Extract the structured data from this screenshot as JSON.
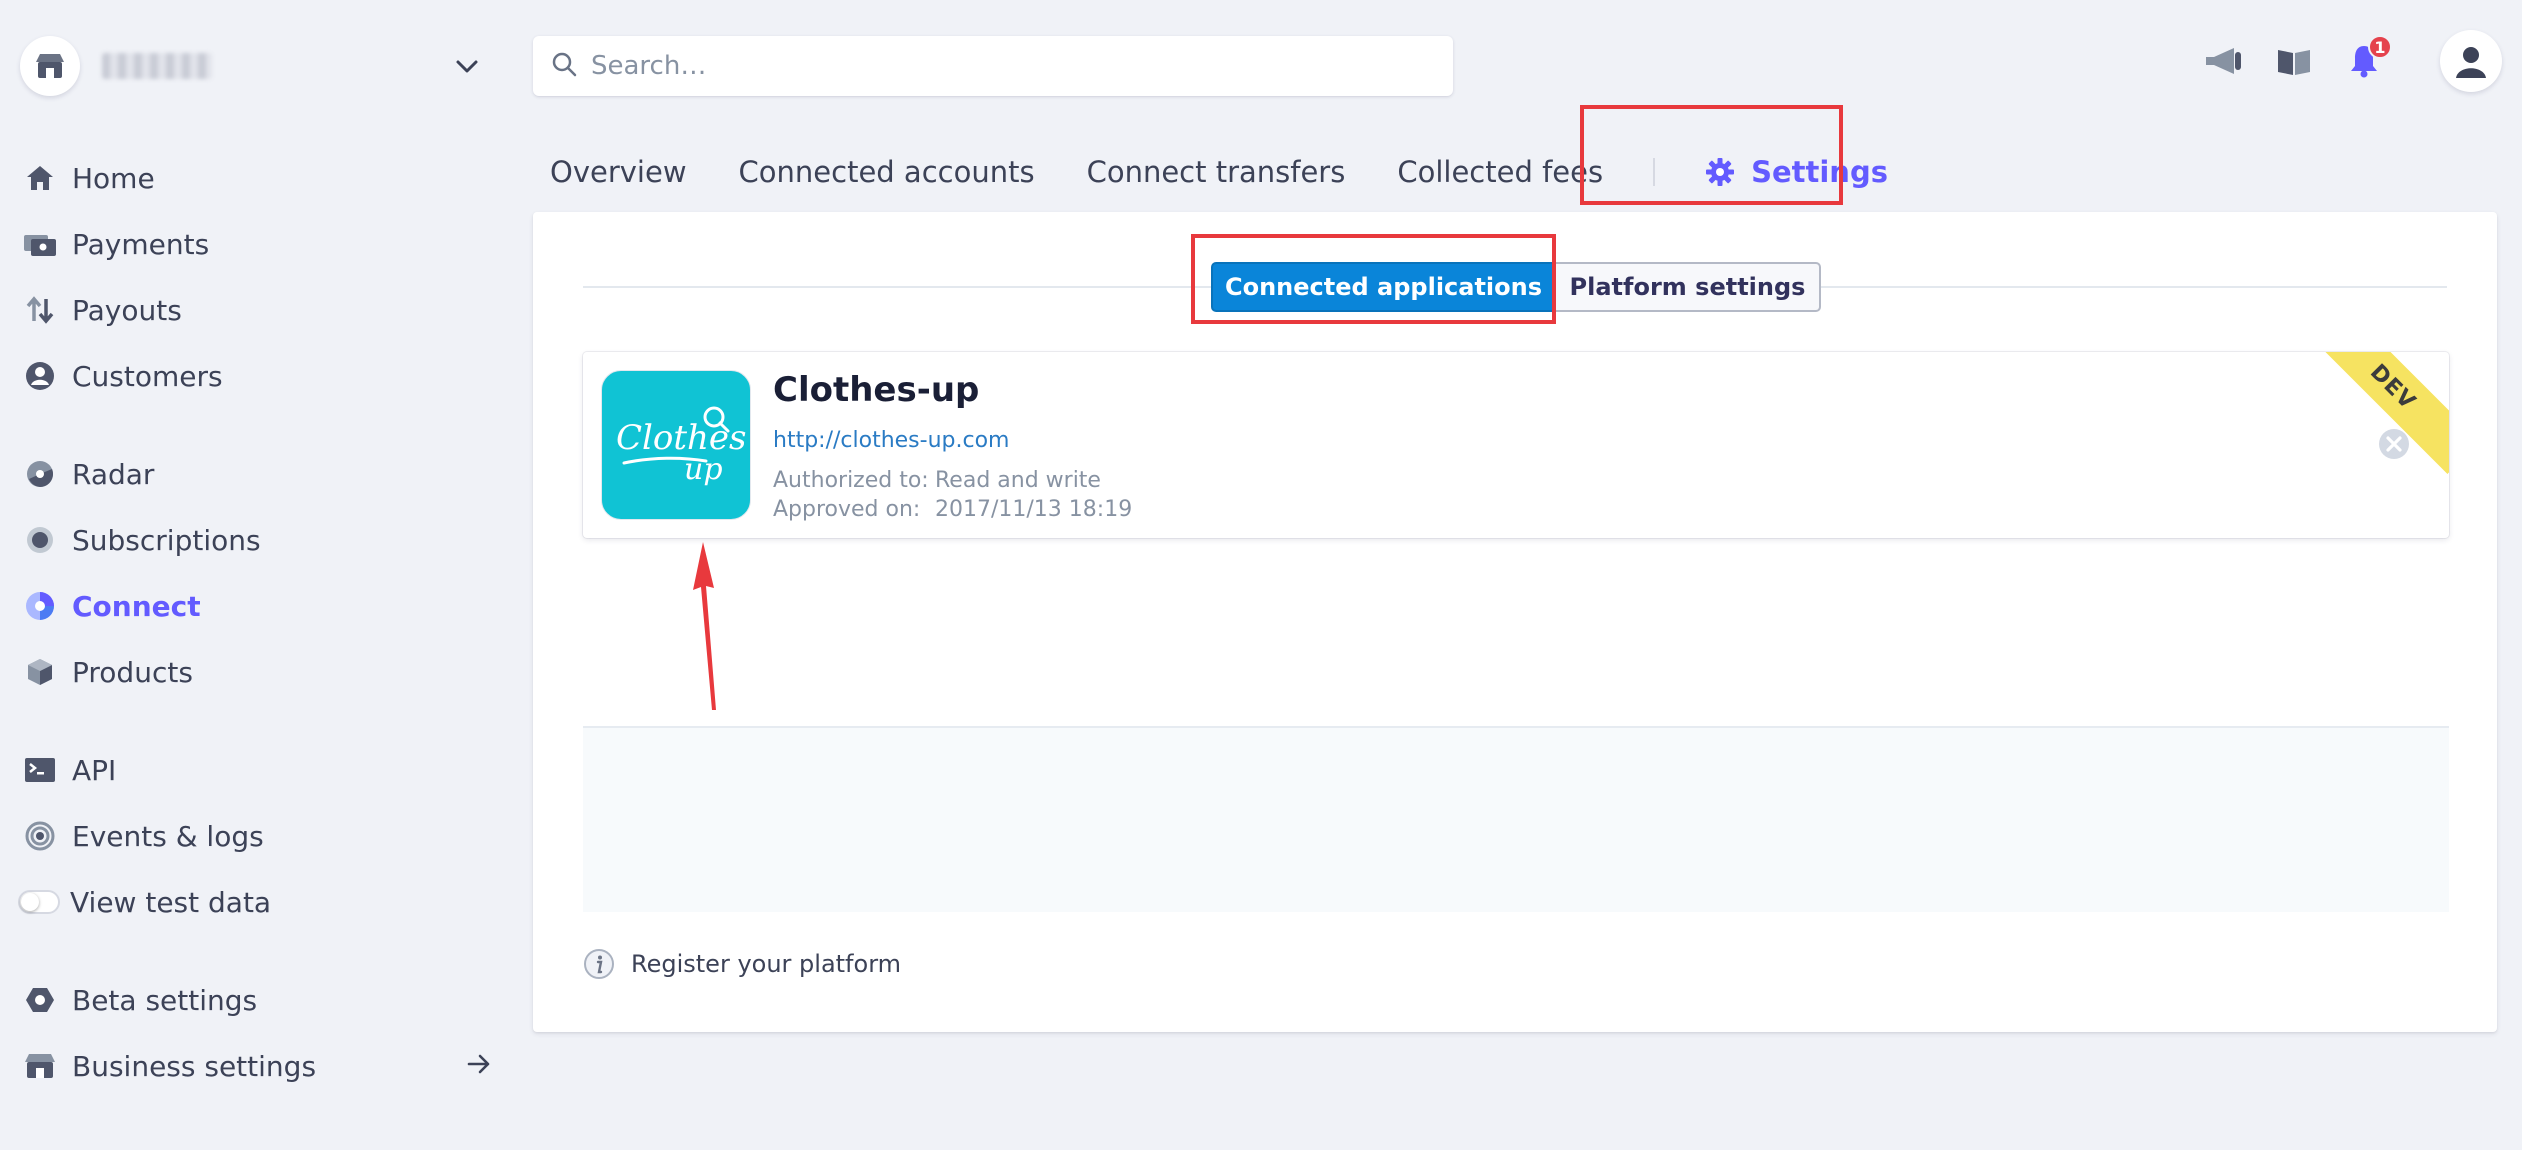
{
  "account": {
    "name": "",
    "icon": "store-icon",
    "menu_icon": "chevron-down-icon"
  },
  "sidebar": {
    "items": [
      {
        "label": "Home",
        "icon": "home-icon"
      },
      {
        "label": "Payments",
        "icon": "payments-icon"
      },
      {
        "label": "Payouts",
        "icon": "payouts-icon"
      },
      {
        "label": "Customers",
        "icon": "customers-icon"
      },
      {
        "label": "Radar",
        "icon": "radar-icon"
      },
      {
        "label": "Subscriptions",
        "icon": "subscriptions-icon"
      },
      {
        "label": "Connect",
        "icon": "connect-icon",
        "active": true
      },
      {
        "label": "Products",
        "icon": "products-icon"
      },
      {
        "label": "API",
        "icon": "terminal-icon"
      },
      {
        "label": "Events & logs",
        "icon": "events-icon"
      },
      {
        "label": "View test data",
        "icon": "toggle"
      },
      {
        "label": "Beta settings",
        "icon": "hexagon-icon"
      },
      {
        "label": "Business settings",
        "icon": "store-icon"
      }
    ]
  },
  "search": {
    "placeholder": "Search…",
    "value": ""
  },
  "topbar": {
    "notifications_count": "1"
  },
  "tabs": [
    {
      "label": "Overview"
    },
    {
      "label": "Connected accounts"
    },
    {
      "label": "Connect transfers"
    },
    {
      "label": "Collected fees"
    },
    {
      "label": "Settings",
      "active": true
    }
  ],
  "settings": {
    "segments": {
      "active": "Connected applications",
      "inactive": "Platform settings"
    },
    "app": {
      "name": "Clothes-up",
      "url": "http://clothes-up.com",
      "authorized_label": "Authorized to:",
      "authorized_value": "Read and write",
      "approved_label": "Approved on:",
      "approved_value": "2017/11/13 18:19",
      "ribbon": "DEV",
      "logo_text_1": "Clothes",
      "logo_text_2": "up"
    },
    "register_label": "Register your platform"
  },
  "colors": {
    "accent": "#635bff",
    "primary_button": "#0a85d9",
    "highlight": "#e8393d",
    "logo_bg": "#10c3d4",
    "ribbon": "#f6e361"
  }
}
